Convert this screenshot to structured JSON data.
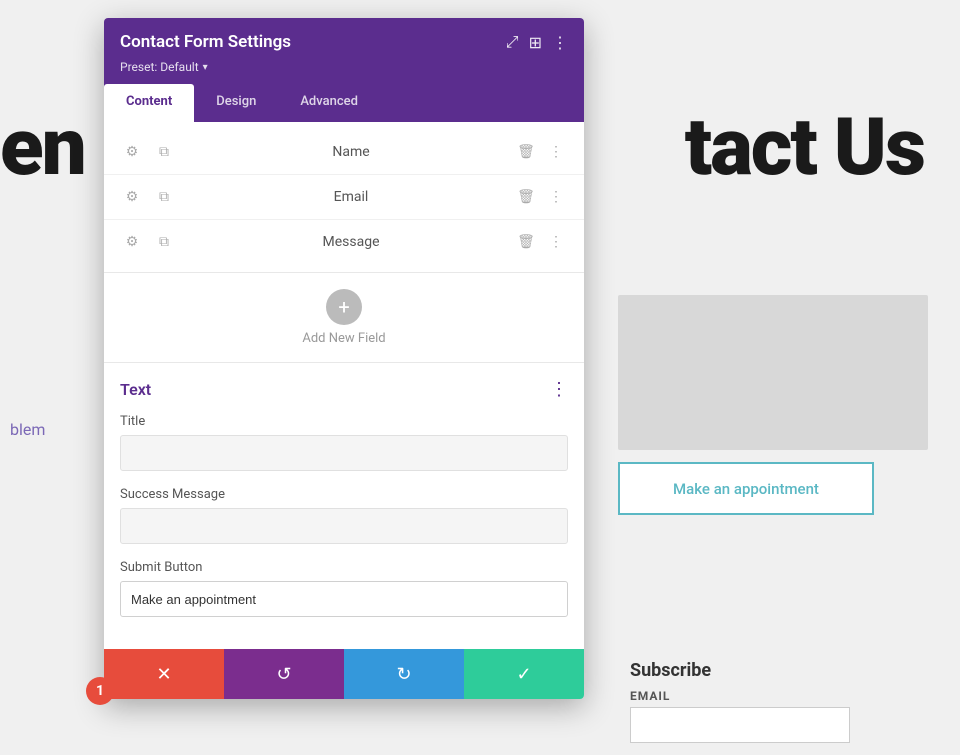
{
  "background": {
    "heading": "tact Us",
    "heading_prefix": "en",
    "side_text": "blem",
    "appointment_btn": "Make an appointment",
    "subscribe_title": "Subscribe",
    "email_label": "EMAIL"
  },
  "panel": {
    "title": "Contact Form Settings",
    "preset_label": "Preset: Default",
    "preset_arrow": "▾",
    "tabs": [
      {
        "label": "Content",
        "active": true
      },
      {
        "label": "Design",
        "active": false
      },
      {
        "label": "Advanced",
        "active": false
      }
    ],
    "fields": [
      {
        "label": "Name"
      },
      {
        "label": "Email"
      },
      {
        "label": "Message"
      }
    ],
    "add_field_label": "Add New Field",
    "add_field_icon": "+",
    "text_section": {
      "title": "Text",
      "title_label": "Title",
      "title_value": "",
      "success_message_label": "Success Message",
      "success_message_value": "",
      "submit_button_label": "Submit Button",
      "submit_button_value": "Make an appointment"
    },
    "footer": {
      "cancel_icon": "✕",
      "undo_icon": "↺",
      "redo_icon": "↻",
      "save_icon": "✓"
    }
  },
  "badge": {
    "value": "1"
  },
  "icons": {
    "gear": "⚙",
    "copy": "⧉",
    "trash": "🗑",
    "dots": "⋮",
    "expand": "⤢",
    "grid": "⊞",
    "more": "⋮"
  }
}
